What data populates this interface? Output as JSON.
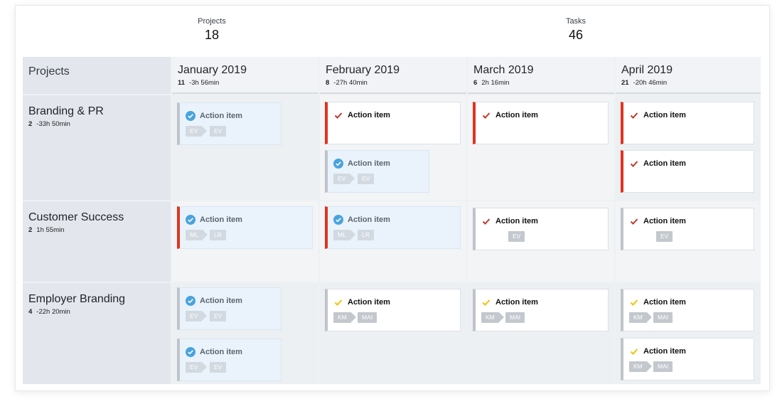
{
  "stats": {
    "projects": {
      "label": "Projects",
      "value": "18"
    },
    "tasks": {
      "label": "Tasks",
      "value": "46"
    }
  },
  "header": {
    "corner_label": "Projects"
  },
  "months": [
    {
      "name": "January 2019",
      "count": "11",
      "time": "-3h 56min"
    },
    {
      "name": "February 2019",
      "count": "8",
      "time": "-27h 40min"
    },
    {
      "name": "March 2019",
      "count": "6",
      "time": "2h 16min"
    },
    {
      "name": "April 2019",
      "count": "21",
      "time": "-20h 46min"
    }
  ],
  "projects": [
    {
      "name": "Branding & PR",
      "count": "2",
      "time": "-33h 50min"
    },
    {
      "name": "Customer Success",
      "count": "2",
      "time": "1h 55min"
    },
    {
      "name": "Employer Branding",
      "count": "4",
      "time": "-22h 20min"
    }
  ],
  "cards": {
    "r0m0a": {
      "title": "Action item",
      "tag1": "EV",
      "tag2": "EV"
    },
    "r0m1a": {
      "title": "Action item"
    },
    "r0m1b": {
      "title": "Action item",
      "tag1": "EV",
      "tag2": "EV"
    },
    "r0m2a": {
      "title": "Action item"
    },
    "r0m3a": {
      "title": "Action item"
    },
    "r0m3b": {
      "title": "Action item"
    },
    "r1m0a": {
      "title": "Action item",
      "tag1": "ML",
      "tag2": "LR"
    },
    "r1m1a": {
      "title": "Action item",
      "tag1": "ML",
      "tag2": "LR"
    },
    "r1m2a": {
      "title": "Action item",
      "tag2": "EV"
    },
    "r1m3a": {
      "title": "Action item",
      "tag2": "EV"
    },
    "r2m0a": {
      "title": "Action item",
      "tag1": "EV",
      "tag2": "EV"
    },
    "r2m0b": {
      "title": "Action item",
      "tag1": "EV",
      "tag2": "EV"
    },
    "r2m1a": {
      "title": "Action item",
      "tag1": "KM",
      "tag2": "MAI"
    },
    "r2m2a": {
      "title": "Action item",
      "tag1": "KM",
      "tag2": "MAI"
    },
    "r2m3a": {
      "title": "Action item",
      "tag1": "KM",
      "tag2": "MAI"
    },
    "r2m3b": {
      "title": "Action item",
      "tag1": "KM",
      "tag2": "MAI"
    }
  },
  "colors": {
    "accent_red": "#e0331f",
    "done_blue": "#4aa3df",
    "check_red": "#c0392b",
    "check_yellow": "#f2c200"
  }
}
